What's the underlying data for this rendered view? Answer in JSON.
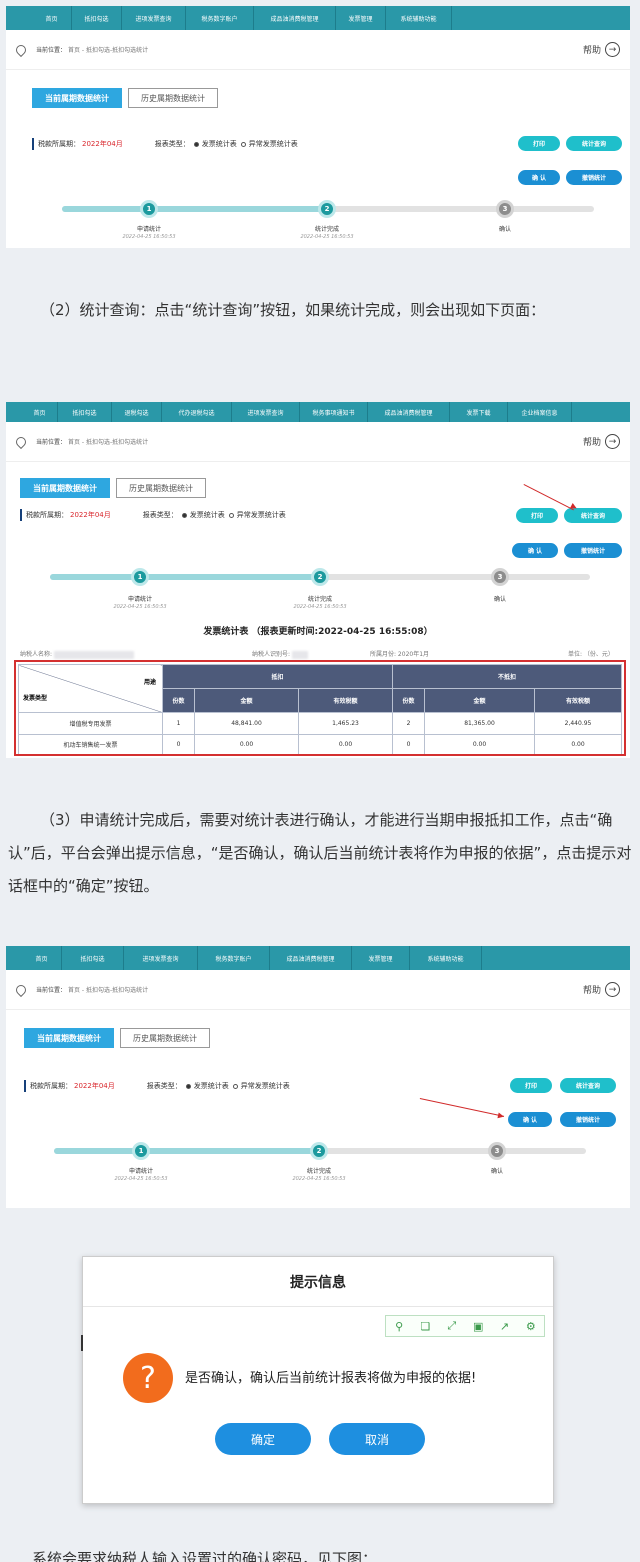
{
  "screens": {
    "s1": {
      "nav": [
        "首页",
        "抵扣勾选",
        "进项发票查询",
        "税务数字账户",
        "成品油消费税管理",
        "发票管理",
        "系统辅助功能"
      ],
      "crumb_label": "当前位置：",
      "crumb_path": "首页 - 抵扣勾选-抵扣勾选统计",
      "help": "帮助",
      "tab_active": "当前属期数据统计",
      "tab_other": "历史属期数据统计",
      "period_label": "税款所属期：",
      "period_value": "2022年04月",
      "type_label": "报表类型：",
      "type_opt1": "发票统计表",
      "type_opt2": "异常发票统计表",
      "btn_print": "打印",
      "btn_query": "统计查询",
      "btn_confirm": "确 认",
      "btn_cancel_stat": "撤销统计",
      "steps": [
        {
          "num": "1",
          "label": "申请统计",
          "time": "2022-04-25 16:50:53"
        },
        {
          "num": "2",
          "label": "统计完成",
          "time": "2022-04-25 16:50:53"
        },
        {
          "num": "3",
          "label": "确认",
          "time": ""
        }
      ]
    },
    "s2": {
      "nav": [
        "首页",
        "抵扣勾选",
        "退税勾选",
        "代办退税勾选",
        "进项发票查询",
        "税务事项通知书",
        "成品油消费税管理",
        "发票下载",
        "企业档案信息"
      ],
      "crumb_label": "当前位置：",
      "crumb_path": "首页 - 抵扣勾选-抵扣勾选统计",
      "help": "帮助",
      "tab_active": "当前属期数据统计",
      "tab_other": "历史属期数据统计",
      "period_label": "税款所属期：",
      "period_value": "2022年04月",
      "type_label": "报表类型：",
      "type_opt1": "发票统计表",
      "type_opt2": "异常发票统计表",
      "btn_print": "打印",
      "btn_query": "统计查询",
      "btn_confirm": "确 认",
      "btn_cancel_stat": "撤销统计",
      "steps": [
        {
          "num": "1",
          "label": "申请统计",
          "time": "2022-04-25 16:50:53"
        },
        {
          "num": "2",
          "label": "统计完成",
          "time": "2022-04-25 16:50:53"
        },
        {
          "num": "3",
          "label": "确认",
          "time": ""
        }
      ],
      "table_title": "发票统计表 （报表更新时间:2022-04-25 16:55:08）",
      "taxpayer_name_label": "纳税人名称:",
      "taxpayer_id_label": "纳税人识别号:",
      "month_label": "所属月份: 2020年1月",
      "unit_label": "单位: （份、元）",
      "corner_left": "发票类型",
      "corner_right": "用途",
      "group_deduct": "抵扣",
      "group_nondeduct": "不抵扣",
      "col_heads": [
        "份数",
        "金额",
        "有效税额",
        "份数",
        "金额",
        "有效税额"
      ],
      "rows": [
        [
          "增值税专用发票",
          "1",
          "48,841.00",
          "1,465.23",
          "2",
          "81,365.00",
          "2,440.95"
        ],
        [
          "机动车销售统一发票",
          "0",
          "0.00",
          "0.00",
          "0",
          "0.00",
          "0.00"
        ]
      ]
    },
    "s3": {
      "nav": [
        "首页",
        "抵扣勾选",
        "进项发票查询",
        "税务数字账户",
        "成品油消费税管理",
        "发票管理",
        "系统辅助功能"
      ],
      "crumb_label": "当前位置：",
      "crumb_path": "首页 - 抵扣勾选-抵扣勾选统计",
      "help": "帮助",
      "tab_active": "当前属期数据统计",
      "tab_other": "历史属期数据统计",
      "period_label": "税款所属期：",
      "period_value": "2022年04月",
      "type_label": "报表类型：",
      "type_opt1": "发票统计表",
      "type_opt2": "异常发票统计表",
      "btn_print": "打印",
      "btn_query": "统计查询",
      "btn_confirm": "确 认",
      "btn_cancel_stat": "撤销统计",
      "steps": [
        {
          "num": "1",
          "label": "申请统计",
          "time": "2022-04-25 16:50:53"
        },
        {
          "num": "2",
          "label": "统计完成",
          "time": "2022-04-25 16:50:53"
        },
        {
          "num": "3",
          "label": "确认",
          "time": ""
        }
      ]
    }
  },
  "text": {
    "p2": "（2）统计查询：点击“统计查询”按钮，如果统计完成，则会出现如下页面：",
    "p3": "（3）申请统计完成后，需要对统计表进行确认，才能进行当期申报抵扣工作，点击“确认”后，平台会弹出提示信息，“是否确认，确认后当前统计表将作为申报的依据”，点击提示对话框中的“确定”按钮。",
    "footer": "系统会要求纳税人输入设置过的确认密码，见下图："
  },
  "dialog": {
    "title": "提示信息",
    "message": "是否确认，确认后当前统计报表将做为申报的依据!",
    "ok": "确定",
    "cancel": "取消",
    "icon": "?"
  },
  "colors": {
    "nav": "#2a98a8",
    "tab_active": "#2ea7e0",
    "btn_teal": "#1fbfcb",
    "btn_blue": "#1b8fd3",
    "period_red": "#d9262c",
    "table_header": "#4d5a7a",
    "highlight_red": "#d43030"
  }
}
